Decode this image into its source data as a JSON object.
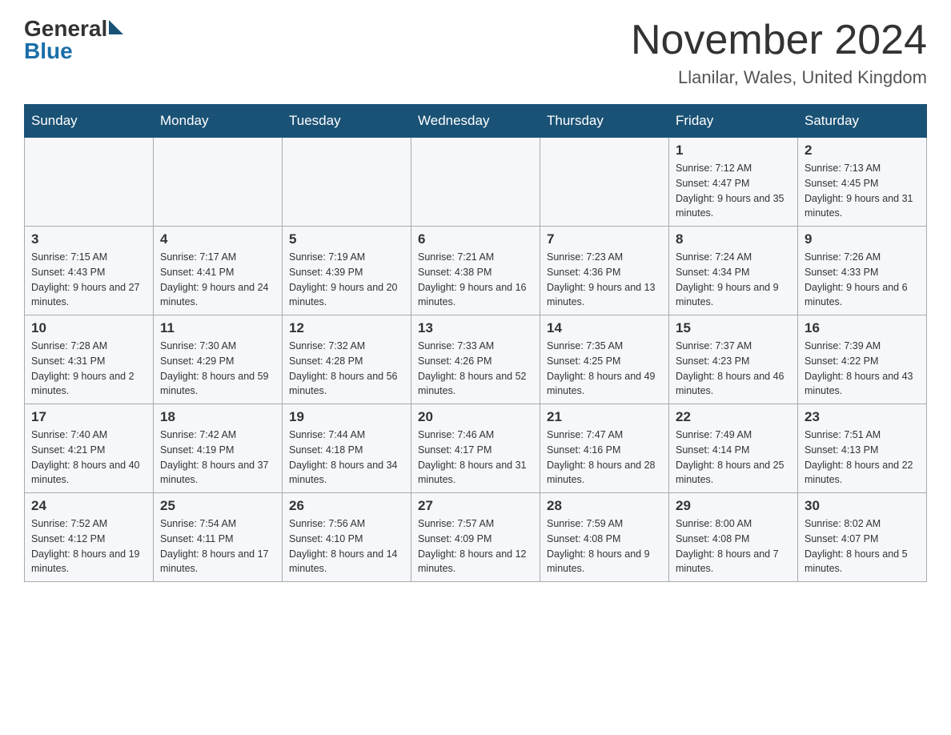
{
  "header": {
    "logo_general": "General",
    "logo_blue": "Blue",
    "month_title": "November 2024",
    "location": "Llanilar, Wales, United Kingdom"
  },
  "weekdays": [
    "Sunday",
    "Monday",
    "Tuesday",
    "Wednesday",
    "Thursday",
    "Friday",
    "Saturday"
  ],
  "weeks": [
    {
      "days": [
        {
          "num": "",
          "info": ""
        },
        {
          "num": "",
          "info": ""
        },
        {
          "num": "",
          "info": ""
        },
        {
          "num": "",
          "info": ""
        },
        {
          "num": "",
          "info": ""
        },
        {
          "num": "1",
          "info": "Sunrise: 7:12 AM\nSunset: 4:47 PM\nDaylight: 9 hours and 35 minutes."
        },
        {
          "num": "2",
          "info": "Sunrise: 7:13 AM\nSunset: 4:45 PM\nDaylight: 9 hours and 31 minutes."
        }
      ]
    },
    {
      "days": [
        {
          "num": "3",
          "info": "Sunrise: 7:15 AM\nSunset: 4:43 PM\nDaylight: 9 hours and 27 minutes."
        },
        {
          "num": "4",
          "info": "Sunrise: 7:17 AM\nSunset: 4:41 PM\nDaylight: 9 hours and 24 minutes."
        },
        {
          "num": "5",
          "info": "Sunrise: 7:19 AM\nSunset: 4:39 PM\nDaylight: 9 hours and 20 minutes."
        },
        {
          "num": "6",
          "info": "Sunrise: 7:21 AM\nSunset: 4:38 PM\nDaylight: 9 hours and 16 minutes."
        },
        {
          "num": "7",
          "info": "Sunrise: 7:23 AM\nSunset: 4:36 PM\nDaylight: 9 hours and 13 minutes."
        },
        {
          "num": "8",
          "info": "Sunrise: 7:24 AM\nSunset: 4:34 PM\nDaylight: 9 hours and 9 minutes."
        },
        {
          "num": "9",
          "info": "Sunrise: 7:26 AM\nSunset: 4:33 PM\nDaylight: 9 hours and 6 minutes."
        }
      ]
    },
    {
      "days": [
        {
          "num": "10",
          "info": "Sunrise: 7:28 AM\nSunset: 4:31 PM\nDaylight: 9 hours and 2 minutes."
        },
        {
          "num": "11",
          "info": "Sunrise: 7:30 AM\nSunset: 4:29 PM\nDaylight: 8 hours and 59 minutes."
        },
        {
          "num": "12",
          "info": "Sunrise: 7:32 AM\nSunset: 4:28 PM\nDaylight: 8 hours and 56 minutes."
        },
        {
          "num": "13",
          "info": "Sunrise: 7:33 AM\nSunset: 4:26 PM\nDaylight: 8 hours and 52 minutes."
        },
        {
          "num": "14",
          "info": "Sunrise: 7:35 AM\nSunset: 4:25 PM\nDaylight: 8 hours and 49 minutes."
        },
        {
          "num": "15",
          "info": "Sunrise: 7:37 AM\nSunset: 4:23 PM\nDaylight: 8 hours and 46 minutes."
        },
        {
          "num": "16",
          "info": "Sunrise: 7:39 AM\nSunset: 4:22 PM\nDaylight: 8 hours and 43 minutes."
        }
      ]
    },
    {
      "days": [
        {
          "num": "17",
          "info": "Sunrise: 7:40 AM\nSunset: 4:21 PM\nDaylight: 8 hours and 40 minutes."
        },
        {
          "num": "18",
          "info": "Sunrise: 7:42 AM\nSunset: 4:19 PM\nDaylight: 8 hours and 37 minutes."
        },
        {
          "num": "19",
          "info": "Sunrise: 7:44 AM\nSunset: 4:18 PM\nDaylight: 8 hours and 34 minutes."
        },
        {
          "num": "20",
          "info": "Sunrise: 7:46 AM\nSunset: 4:17 PM\nDaylight: 8 hours and 31 minutes."
        },
        {
          "num": "21",
          "info": "Sunrise: 7:47 AM\nSunset: 4:16 PM\nDaylight: 8 hours and 28 minutes."
        },
        {
          "num": "22",
          "info": "Sunrise: 7:49 AM\nSunset: 4:14 PM\nDaylight: 8 hours and 25 minutes."
        },
        {
          "num": "23",
          "info": "Sunrise: 7:51 AM\nSunset: 4:13 PM\nDaylight: 8 hours and 22 minutes."
        }
      ]
    },
    {
      "days": [
        {
          "num": "24",
          "info": "Sunrise: 7:52 AM\nSunset: 4:12 PM\nDaylight: 8 hours and 19 minutes."
        },
        {
          "num": "25",
          "info": "Sunrise: 7:54 AM\nSunset: 4:11 PM\nDaylight: 8 hours and 17 minutes."
        },
        {
          "num": "26",
          "info": "Sunrise: 7:56 AM\nSunset: 4:10 PM\nDaylight: 8 hours and 14 minutes."
        },
        {
          "num": "27",
          "info": "Sunrise: 7:57 AM\nSunset: 4:09 PM\nDaylight: 8 hours and 12 minutes."
        },
        {
          "num": "28",
          "info": "Sunrise: 7:59 AM\nSunset: 4:08 PM\nDaylight: 8 hours and 9 minutes."
        },
        {
          "num": "29",
          "info": "Sunrise: 8:00 AM\nSunset: 4:08 PM\nDaylight: 8 hours and 7 minutes."
        },
        {
          "num": "30",
          "info": "Sunrise: 8:02 AM\nSunset: 4:07 PM\nDaylight: 8 hours and 5 minutes."
        }
      ]
    }
  ]
}
